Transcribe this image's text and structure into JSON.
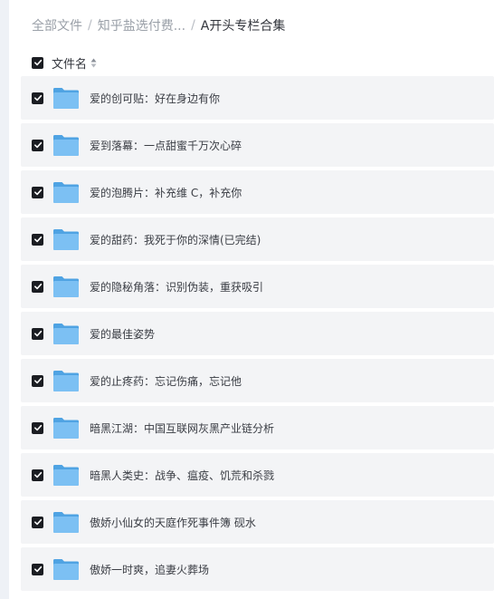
{
  "breadcrumb": {
    "items": [
      "全部文件",
      "知乎盐选付费..."
    ],
    "separator": "/",
    "current": "A开头专栏合集"
  },
  "header": {
    "column_label": "文件名"
  },
  "colors": {
    "checkbox": "#1b1d22",
    "row_bg": "#f3f4f6",
    "folder": "#5aaeea"
  },
  "files": [
    {
      "name": "爱的创可贴：好在身边有你",
      "icon": "folder-icon",
      "checked": true
    },
    {
      "name": "爱到落幕：一点甜蜜千万次心碎",
      "icon": "folder-icon",
      "checked": true
    },
    {
      "name": "爱的泡腾片：补充维 C，补充你",
      "icon": "folder-icon",
      "checked": true
    },
    {
      "name": "爱的甜药：我死于你的深情(已完结)",
      "icon": "folder-icon",
      "checked": true
    },
    {
      "name": "爱的隐秘角落：识别伪装，重获吸引",
      "icon": "folder-icon",
      "checked": true
    },
    {
      "name": "爱的最佳姿势",
      "icon": "folder-icon",
      "checked": true
    },
    {
      "name": "爱的止疼药：忘记伤痛，忘记他",
      "icon": "folder-icon",
      "checked": true
    },
    {
      "name": "暗黑江湖：中国互联网灰黑产业链分析",
      "icon": "folder-icon",
      "checked": true
    },
    {
      "name": "暗黑人类史：战争、瘟疫、饥荒和杀戮",
      "icon": "folder-icon",
      "checked": true
    },
    {
      "name": "傲娇小仙女的天庭作死事件簿 砚水",
      "icon": "folder-icon",
      "checked": true
    },
    {
      "name": "傲娇一时爽，追妻火葬场",
      "icon": "folder-icon",
      "checked": true
    }
  ]
}
